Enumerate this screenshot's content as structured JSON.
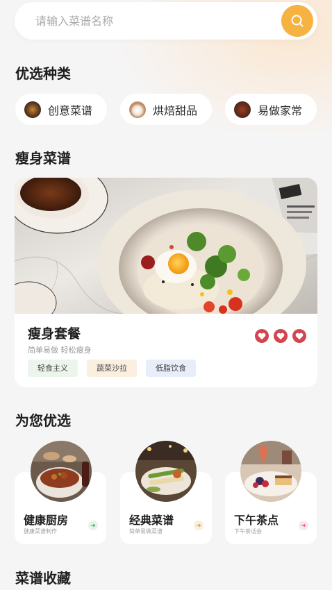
{
  "search": {
    "placeholder": "请输入菜谱名称",
    "icon": "search-icon"
  },
  "sections": {
    "categories_title": "优选种类",
    "slim_title": "瘦身菜谱",
    "recommend_title": "为您优选",
    "favorites_title": "菜谱收藏"
  },
  "categories": [
    {
      "label": "创意菜谱"
    },
    {
      "label": "烘焙甜品"
    },
    {
      "label": "易做家常"
    }
  ],
  "feature": {
    "title": "瘦身套餐",
    "subtitle": "简单易做  轻松瘦身",
    "tags": [
      "轻食主义",
      "蔬菜沙拉",
      "低脂饮食"
    ],
    "favorites": 3
  },
  "recommend": [
    {
      "title": "健康厨房",
      "subtitle": "健康菜谱制作"
    },
    {
      "title": "经典菜谱",
      "subtitle": "简单易做菜谱"
    },
    {
      "title": "下午茶点",
      "subtitle": "下午茶话会"
    }
  ],
  "colors": {
    "accent": "#f6b341",
    "heart": "#d4454f",
    "tag_green": "#ebf5ec",
    "tag_orange": "#fbefe0",
    "tag_blue": "#e7eef9"
  }
}
